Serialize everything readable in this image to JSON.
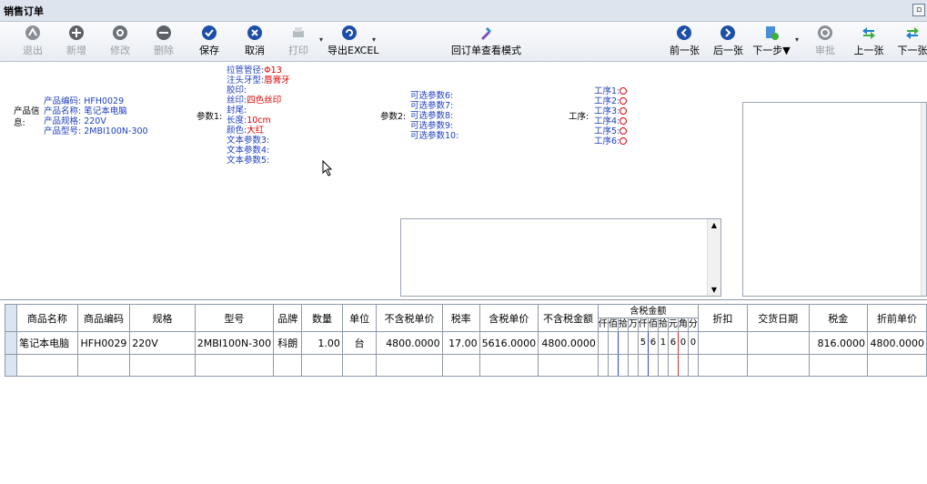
{
  "window": {
    "title": "销售订单",
    "restore_icon": "restore-icon"
  },
  "toolbar": {
    "exit": "退出",
    "new": "新增",
    "edit": "修改",
    "delete": "删除",
    "save": "保存",
    "cancel": "取消",
    "print": "打印",
    "export": "导出EXCEL",
    "view_mode": "回订单查看模式",
    "prev": "前一张",
    "next": "后一张",
    "next_step": "下一步▼",
    "approve": "审批",
    "up": "上一张",
    "down": "下一张"
  },
  "product_info": {
    "label": "产品信息:",
    "lines": [
      "产品编码: HFH0029",
      "产品名称: 笔记本电脑",
      "产品规格: 220V",
      "产品型号: 2MBI100N-300"
    ]
  },
  "params1": {
    "label": "参数1:",
    "lines": [
      {
        "k": "拉管管径:",
        "v": "Φ13"
      },
      {
        "k": "注头牙型:",
        "v": "唇膏牙"
      },
      {
        "k": "胶印:",
        "v": ""
      },
      {
        "k": "丝印:",
        "v": "四色丝印"
      },
      {
        "k": "封尾:",
        "v": ""
      },
      {
        "k": "长度:",
        "v": "10cm"
      },
      {
        "k": "颜色:",
        "v": "大红"
      },
      {
        "k": "文本参数3:",
        "v": ""
      },
      {
        "k": "文本参数4:",
        "v": ""
      },
      {
        "k": "文本参数5:",
        "v": ""
      }
    ]
  },
  "params2": {
    "label": "参数2:",
    "lines": [
      "可选参数6:",
      "可选参数7:",
      "可选参数8:",
      "可选参数9:",
      "可选参数10:"
    ]
  },
  "process": {
    "label": "工序:",
    "lines": [
      "工序1:",
      "工序2:",
      "工序3:",
      "工序4:",
      "工序5:",
      "工序6:"
    ]
  },
  "grid": {
    "headers": [
      "商品名称",
      "商品编码",
      "规格",
      "型号",
      "品牌",
      "数量",
      "单位",
      "不含税单价",
      "税率",
      "含税单价",
      "不含税金额",
      "含税金额",
      "折扣",
      "交货日期",
      "税金",
      "折前单价"
    ],
    "money_units": [
      "仟",
      "佰",
      "拾",
      "万",
      "仟",
      "佰",
      "拾",
      "元",
      "角",
      "分"
    ],
    "rows": [
      {
        "name": "笔记本电脑",
        "code": "HFH0029",
        "spec": "220V",
        "model": "2MBI100N-300",
        "brand": "科朗",
        "qty": "1.00",
        "unit": "台",
        "price_ex": "4800.0000",
        "tax_rate": "17.00",
        "price_in": "5616.0000",
        "amount_ex": "4800.0000",
        "amount_digits": [
          "",
          "",
          "",
          "",
          "5",
          "6",
          "1",
          "6",
          "0",
          "0"
        ],
        "discount": "",
        "delivery": "",
        "tax": "816.0000",
        "pre_price": "4800.0000"
      }
    ]
  }
}
